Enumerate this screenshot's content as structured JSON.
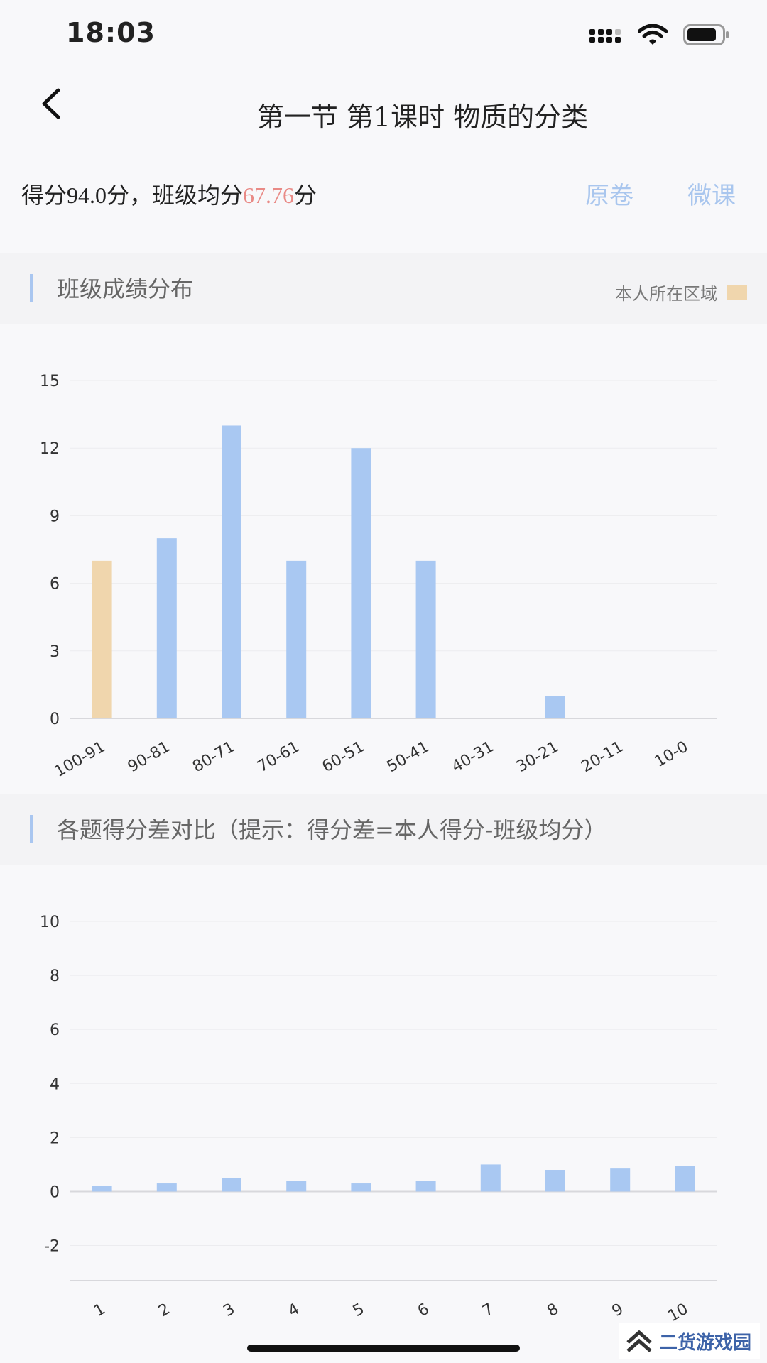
{
  "status_bar": {
    "time": "18:03"
  },
  "nav": {
    "title": "第一节 第1课时 物质的分类"
  },
  "score": {
    "prefix": "得分94.0分，班级均分",
    "class_avg": "67.76",
    "suffix": "分",
    "original_paper_label": "原卷",
    "micro_lesson_label": "微课"
  },
  "distribution_section": {
    "title": "班级成绩分布",
    "legend_label": "本人所在区域"
  },
  "diff_section": {
    "title": "各题得分差对比（提示：得分差=本人得分-班级均分）"
  },
  "colors": {
    "bar": "#a9c8f2",
    "highlight_bar": "#f0d6ad",
    "accent": "#a9c6ee",
    "avg_value": "#e98a86"
  },
  "chart_data": [
    {
      "type": "bar",
      "categories": [
        "100-91",
        "90-81",
        "80-71",
        "70-61",
        "60-51",
        "50-41",
        "40-31",
        "30-21",
        "20-11",
        "10-0"
      ],
      "values": [
        7,
        8,
        13,
        7,
        12,
        7,
        0,
        1,
        0,
        0
      ],
      "highlight_index": 0,
      "yticks": [
        0,
        3,
        6,
        9,
        12,
        15
      ],
      "ylim": [
        0,
        15
      ]
    },
    {
      "type": "bar",
      "categories": [
        "1",
        "2",
        "3",
        "4",
        "5",
        "6",
        "7",
        "8",
        "9",
        "10"
      ],
      "values": [
        0.2,
        0.3,
        0.5,
        0.4,
        0.3,
        0.4,
        1.0,
        0.8,
        0.85,
        0.95
      ],
      "yticks": [
        -2,
        0,
        2,
        4,
        6,
        8,
        10
      ],
      "ylim": [
        -3.3,
        10
      ]
    }
  ],
  "watermark": {
    "text": "二货游戏园"
  }
}
